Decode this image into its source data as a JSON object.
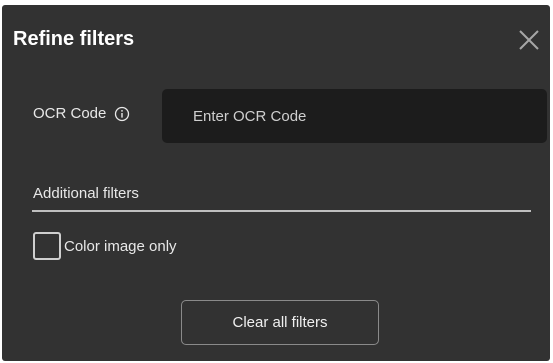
{
  "dialog": {
    "title": "Refine filters",
    "close_icon": "close-icon"
  },
  "ocr": {
    "label": "OCR Code",
    "info_icon": "info-icon",
    "placeholder": "Enter OCR Code",
    "value": ""
  },
  "additional_filters": {
    "title": "Additional filters",
    "color_image_only": {
      "label": "Color image only",
      "checked": false
    }
  },
  "actions": {
    "clear_all_label": "Clear all filters"
  },
  "colors": {
    "dialog_background": "#323232",
    "input_background": "#1c1c1c",
    "text": "#e8e8e8",
    "divider": "#bfbfbf"
  }
}
